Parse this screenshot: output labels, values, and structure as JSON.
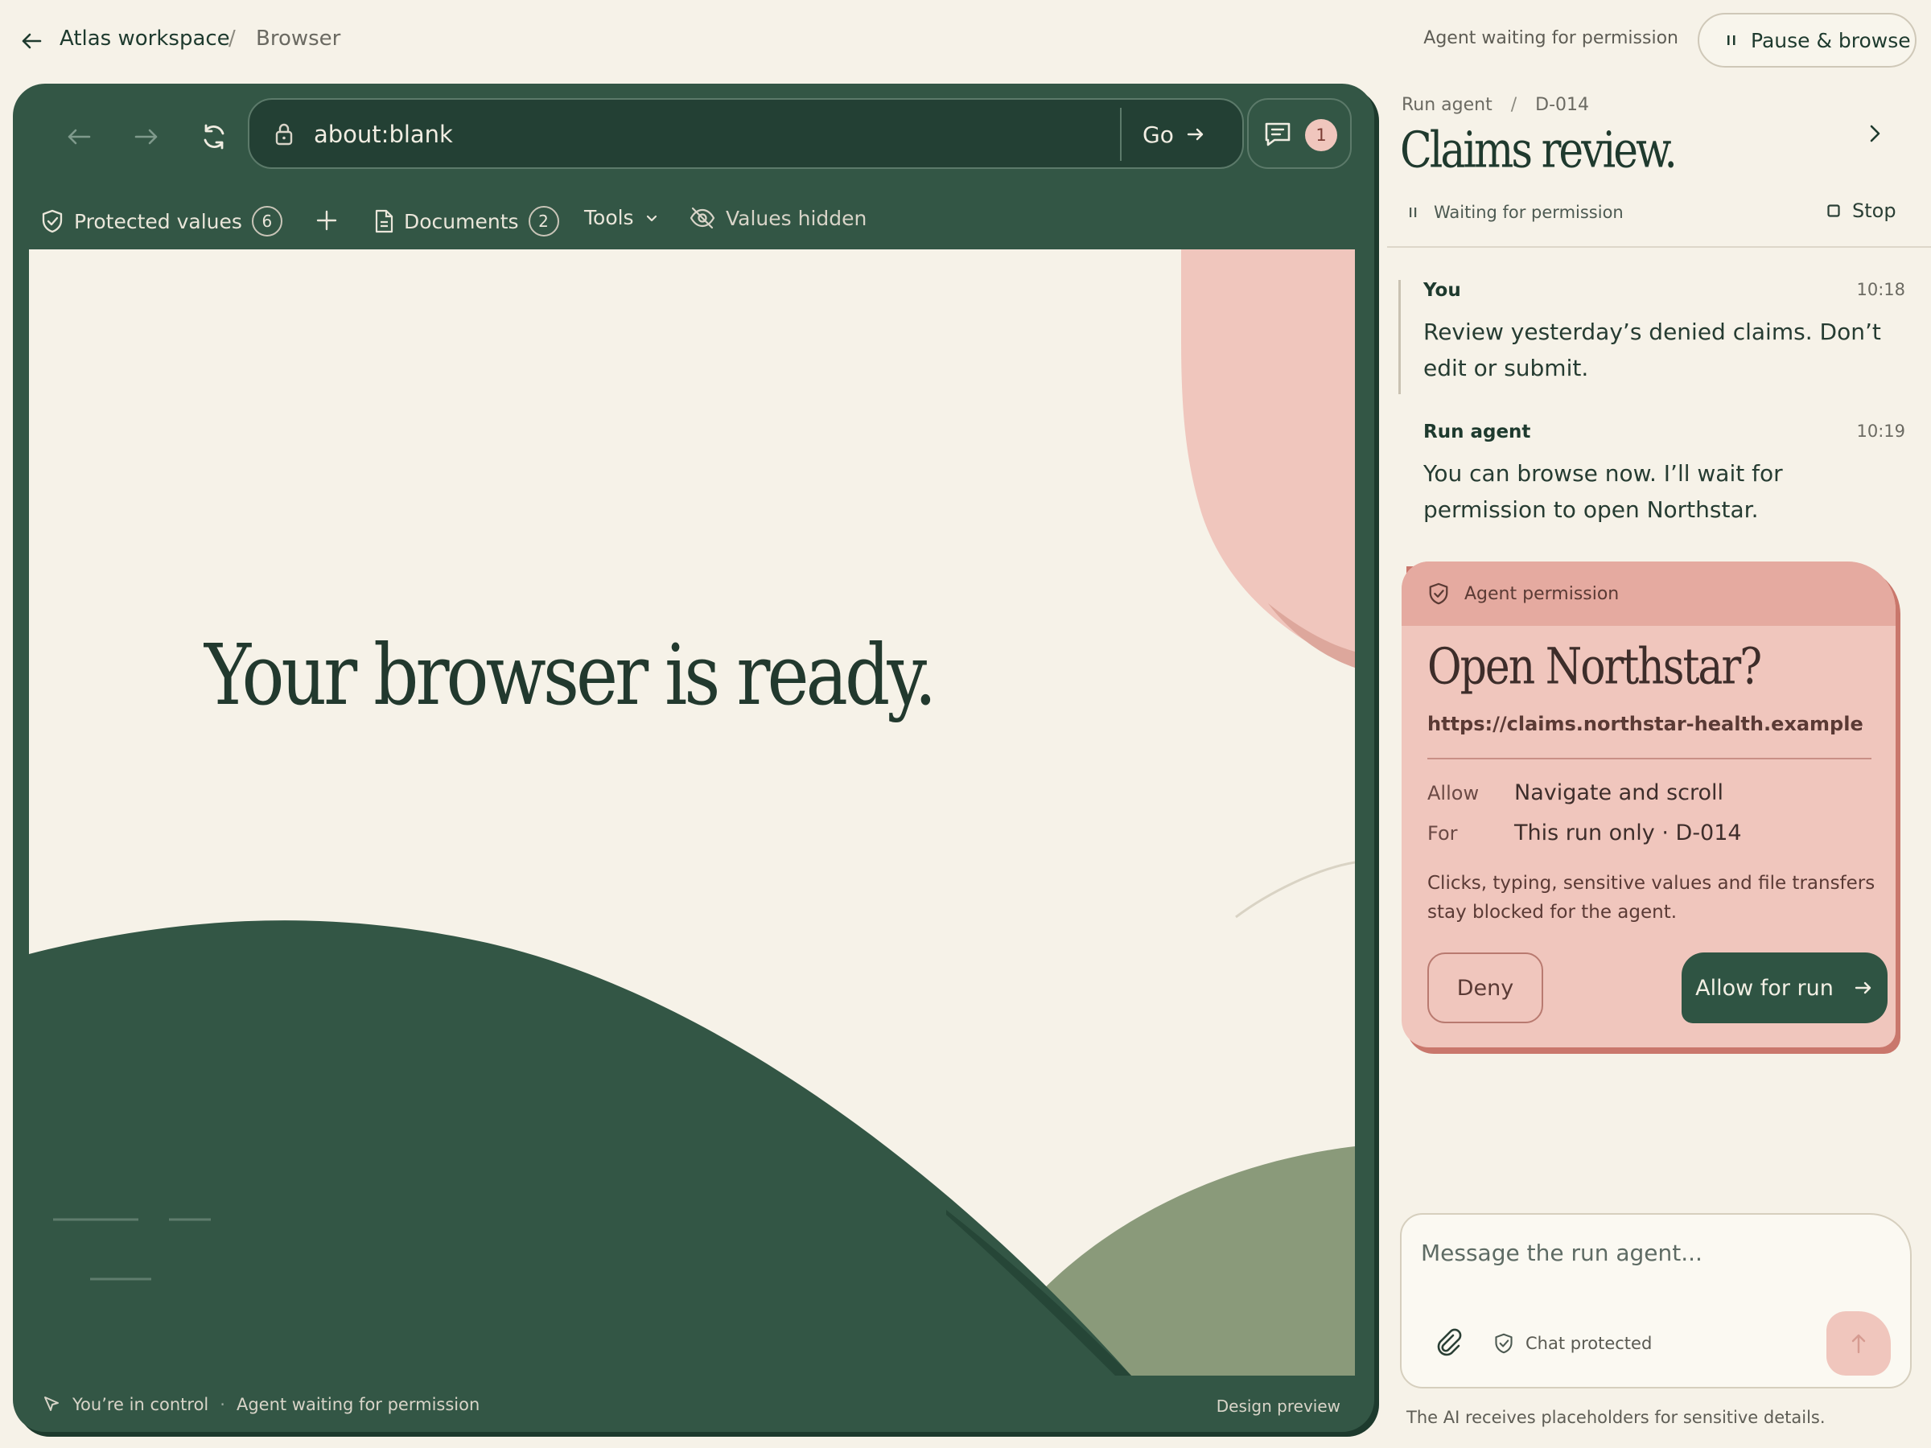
{
  "topbar": {
    "workspace": "Atlas workspace",
    "separator": "/",
    "section": "Browser",
    "status": "Agent waiting for permission",
    "pause_button": "Pause & browse"
  },
  "browser": {
    "url": "about:blank",
    "go_label": "Go",
    "chat_badge": "1",
    "toolbar": {
      "protected_values_label": "Protected values",
      "protected_values_count": "6",
      "documents_label": "Documents",
      "documents_count": "2",
      "tools_label": "Tools",
      "values_hidden_label": "Values hidden"
    },
    "page_headline": "Your browser is ready.",
    "footer": {
      "control": "You’re in control",
      "dot": "·",
      "status": "Agent waiting for permission",
      "preview": "Design preview"
    }
  },
  "panel": {
    "breadcrumb_agent": "Run agent",
    "breadcrumb_sep": "/",
    "breadcrumb_id": "D-014",
    "title": "Claims review.",
    "status": "Waiting for permission",
    "stop_label": "Stop",
    "messages": [
      {
        "author": "You",
        "time": "10:18",
        "text": "Review yesterday’s denied claims. Don’t edit or submit."
      },
      {
        "author": "Run agent",
        "time": "10:19",
        "text": "You can browse now. I’ll wait for permission to open Northstar."
      }
    ],
    "permission": {
      "header": "Agent permission",
      "title": "Open Northstar?",
      "url": "https://claims.northstar-health.example",
      "allow_key": "Allow",
      "allow_value": "Navigate and scroll",
      "for_key": "For",
      "for_value": "This run only · D-014",
      "note": "Clicks, typing, sensitive values and file transfers stay blocked for the agent.",
      "deny_label": "Deny",
      "allow_label": "Allow for run"
    },
    "composer": {
      "placeholder": "Message the run agent...",
      "protected_label": "Chat protected"
    },
    "disclaimer": "The AI receives placeholders for sensitive details."
  },
  "colors": {
    "background": "#f6f2e8",
    "forest": "#335645",
    "sage": "#8a9a7a",
    "blush": "#f0c6bd",
    "deep_blush": "#e5aaa0"
  },
  "icons": [
    "arrow-left-icon",
    "lock-icon",
    "arrow-right-icon",
    "refresh-icon",
    "chat-icon",
    "shield-check-icon",
    "plus-icon",
    "document-icon",
    "chevron-down-icon",
    "eye-off-icon",
    "pointer-icon",
    "pause-icon",
    "stop-icon",
    "chevron-right-icon",
    "paperclip-icon",
    "arrow-up-icon"
  ]
}
